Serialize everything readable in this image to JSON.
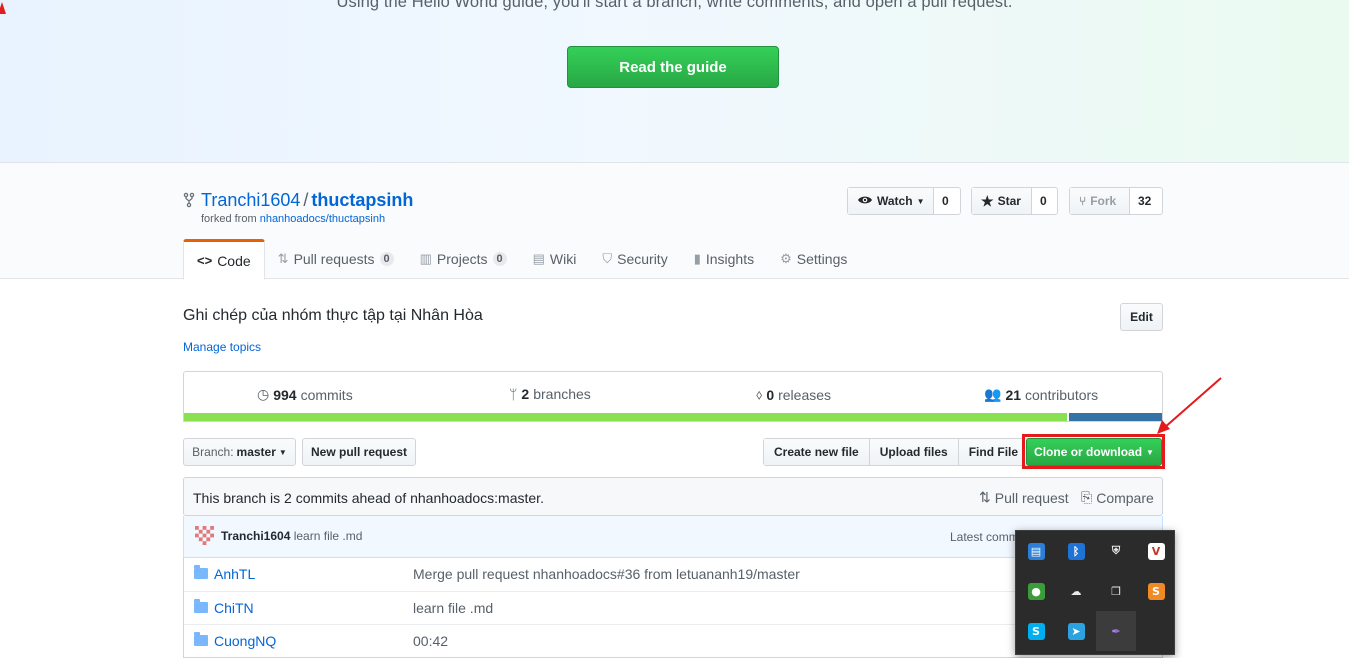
{
  "hero": {
    "text": "Using the Hello World guide, you'll start a branch, write comments, and open a pull request.",
    "button": "Read the guide"
  },
  "repo": {
    "owner": "Tranchi1604",
    "separator": "/",
    "name": "thuctapsinh",
    "forked_prefix": "forked from",
    "forked_from": "nhanhoadocs/thuctapsinh",
    "watch": {
      "label": "Watch",
      "count": "0"
    },
    "star": {
      "label": "Star",
      "count": "0"
    },
    "fork": {
      "label": "Fork",
      "count": "32"
    }
  },
  "tabs": [
    {
      "label": "Code",
      "icon": "code-icon"
    },
    {
      "label": "Pull requests",
      "count": "0",
      "icon": "pull-request-icon"
    },
    {
      "label": "Projects",
      "count": "0",
      "icon": "project-icon"
    },
    {
      "label": "Wiki",
      "icon": "book-icon"
    },
    {
      "label": "Security",
      "icon": "shield-icon"
    },
    {
      "label": "Insights",
      "icon": "graph-icon"
    },
    {
      "label": "Settings",
      "icon": "gear-icon"
    }
  ],
  "about": {
    "description": "Ghi chép của nhóm thực tập tại Nhân Hòa",
    "manage_topics": "Manage topics",
    "edit": "Edit"
  },
  "summary": {
    "commits": {
      "count": "994",
      "label": "commits"
    },
    "branches": {
      "count": "2",
      "label": "branches"
    },
    "releases": {
      "count": "0",
      "label": "releases"
    },
    "contributors": {
      "count": "21",
      "label": "contributors"
    },
    "langbar": [
      {
        "share": 90.3,
        "color": "#89e051"
      },
      {
        "share": 9.7,
        "color": "#3572a5"
      }
    ]
  },
  "toolbar": {
    "branch_prefix": "Branch:",
    "branch": "master",
    "new_pr": "New pull request",
    "create_file": "Create new file",
    "upload_files": "Upload files",
    "find_file": "Find File",
    "clone": "Clone or download"
  },
  "ahead": {
    "message": "This branch is 2 commits ahead of nhanhoadocs:master.",
    "pull_request": "Pull request",
    "compare": "Compare"
  },
  "latest_commit": {
    "author": "Tranchi1604",
    "message": "learn file .md",
    "latest_label": "Latest comm"
  },
  "files": [
    {
      "name": "AnhTL",
      "message": "Merge pull request nhanhoadocs#36 from letuananh19/master"
    },
    {
      "name": "ChiTN",
      "message": "learn file .md"
    },
    {
      "name": "CuongNQ",
      "message": "00:42"
    }
  ],
  "tray": [
    {
      "icon": "network-monitor-icon",
      "color": "#2b7fd6",
      "glyph": "▤"
    },
    {
      "icon": "bluetooth-icon",
      "color": "#1e73d6",
      "glyph": "ᛒ"
    },
    {
      "icon": "defender-shield-icon",
      "color": "#2b2b2b",
      "glyph": "⛨"
    },
    {
      "icon": "v-app-icon",
      "color": "#ffffff",
      "glyph": "V"
    },
    {
      "icon": "globe-app-icon",
      "color": "#3a9d3a",
      "glyph": "●"
    },
    {
      "icon": "cloud-offline-icon",
      "color": "#2b2b2b",
      "glyph": "☁"
    },
    {
      "icon": "copy-app-icon",
      "color": "#2b2b2b",
      "glyph": "❐"
    },
    {
      "icon": "sublime-icon",
      "color": "#f08a24",
      "glyph": "S"
    },
    {
      "icon": "skype-icon",
      "color": "#00aff0",
      "glyph": "S"
    },
    {
      "icon": "telegram-icon",
      "color": "#2aa3e0",
      "glyph": "➤"
    },
    {
      "icon": "feather-icon",
      "color": "#3c3c3c",
      "glyph": "✒"
    }
  ]
}
